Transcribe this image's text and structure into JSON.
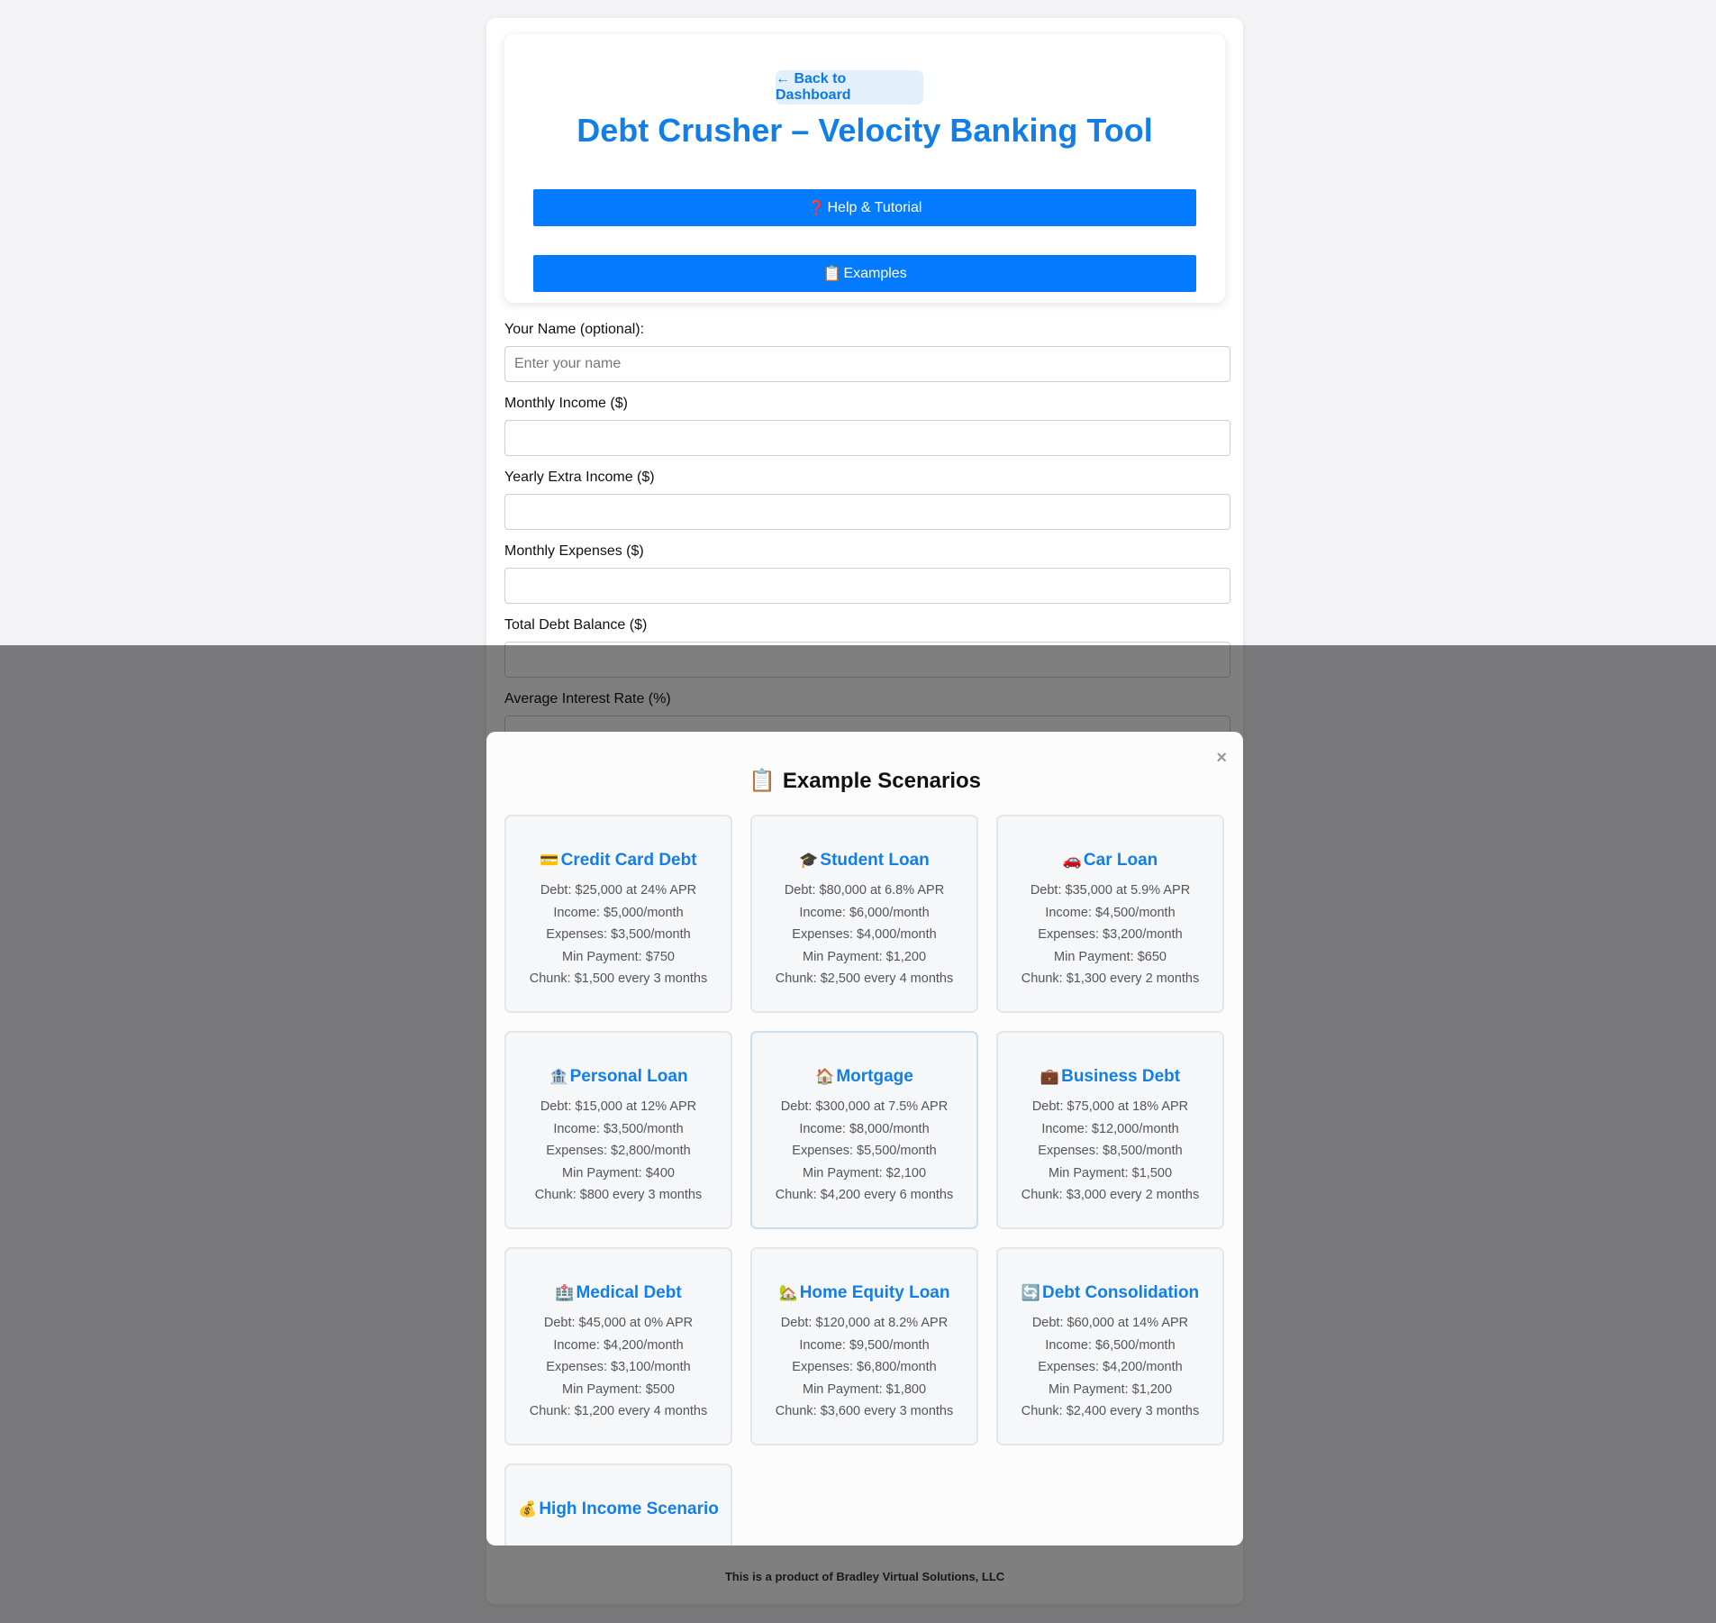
{
  "header": {
    "back_label": "← Back to Dashboard",
    "title": "Debt Crusher – Velocity Banking Tool",
    "help_icon": "❓",
    "help_label": "Help & Tutorial",
    "examples_icon": "📋",
    "examples_label": "Examples"
  },
  "form": {
    "fields": [
      {
        "label": "Your Name (optional):",
        "placeholder": "Enter your name",
        "value": ""
      },
      {
        "label": "Monthly Income ($)",
        "placeholder": "",
        "value": ""
      },
      {
        "label": "Yearly Extra Income ($)",
        "placeholder": "",
        "value": ""
      },
      {
        "label": "Monthly Expenses ($)",
        "placeholder": "",
        "value": ""
      },
      {
        "label": "Total Debt Balance ($)",
        "placeholder": "",
        "value": ""
      },
      {
        "label": "Average Interest Rate (%)",
        "placeholder": "",
        "value": ""
      }
    ]
  },
  "footer": "This is a product of Bradley Virtual Solutions, LLC",
  "modal": {
    "close_label": "×",
    "title_icon": "📋",
    "title": "Example Scenarios",
    "scenarios": [
      {
        "icon": "💳",
        "name": "Credit Card Debt",
        "debt": "Debt: $25,000 at 24% APR",
        "income": "Income: $5,000/month",
        "expenses": "Expenses: $3,500/month",
        "min_payment": "Min Payment: $750",
        "chunk": "Chunk: $1,500 every 3 months"
      },
      {
        "icon": "🎓",
        "name": "Student Loan",
        "debt": "Debt: $80,000 at 6.8% APR",
        "income": "Income: $6,000/month",
        "expenses": "Expenses: $4,000/month",
        "min_payment": "Min Payment: $1,200",
        "chunk": "Chunk: $2,500 every 4 months"
      },
      {
        "icon": "🚗",
        "name": "Car Loan",
        "debt": "Debt: $35,000 at 5.9% APR",
        "income": "Income: $4,500/month",
        "expenses": "Expenses: $3,200/month",
        "min_payment": "Min Payment: $650",
        "chunk": "Chunk: $1,300 every 2 months"
      },
      {
        "icon": "🏦",
        "name": "Personal Loan",
        "debt": "Debt: $15,000 at 12% APR",
        "income": "Income: $3,500/month",
        "expenses": "Expenses: $2,800/month",
        "min_payment": "Min Payment: $400",
        "chunk": "Chunk: $800 every 3 months"
      },
      {
        "icon": "🏠",
        "name": "Mortgage",
        "debt": "Debt: $300,000 at 7.5% APR",
        "income": "Income: $8,000/month",
        "expenses": "Expenses: $5,500/month",
        "min_payment": "Min Payment: $2,100",
        "chunk": "Chunk: $4,200 every 6 months"
      },
      {
        "icon": "💼",
        "name": "Business Debt",
        "debt": "Debt: $75,000 at 18% APR",
        "income": "Income: $12,000/month",
        "expenses": "Expenses: $8,500/month",
        "min_payment": "Min Payment: $1,500",
        "chunk": "Chunk: $3,000 every 2 months"
      },
      {
        "icon": "🏥",
        "name": "Medical Debt",
        "debt": "Debt: $45,000 at 0% APR",
        "income": "Income: $4,200/month",
        "expenses": "Expenses: $3,100/month",
        "min_payment": "Min Payment: $500",
        "chunk": "Chunk: $1,200 every 4 months"
      },
      {
        "icon": "🏡",
        "name": "Home Equity Loan",
        "debt": "Debt: $120,000 at 8.2% APR",
        "income": "Income: $9,500/month",
        "expenses": "Expenses: $6,800/month",
        "min_payment": "Min Payment: $1,800",
        "chunk": "Chunk: $3,600 every 3 months"
      },
      {
        "icon": "🔄",
        "name": "Debt Consolidation",
        "debt": "Debt: $60,000 at 14% APR",
        "income": "Income: $6,500/month",
        "expenses": "Expenses: $4,200/month",
        "min_payment": "Min Payment: $1,200",
        "chunk": "Chunk: $2,400 every 3 months"
      },
      {
        "icon": "💰",
        "name": "High Income Scenario",
        "debt": "",
        "income": "",
        "expenses": "",
        "min_payment": "",
        "chunk": ""
      }
    ]
  }
}
